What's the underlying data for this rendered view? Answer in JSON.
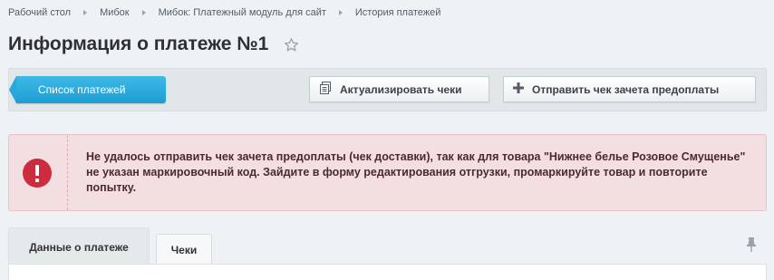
{
  "breadcrumb": [
    {
      "label": "Рабочий стол"
    },
    {
      "label": "Мибок"
    },
    {
      "label": "Мибок: Платежный модуль для сайт"
    },
    {
      "label": "История платежей"
    }
  ],
  "page": {
    "title": "Информация о платеже №1"
  },
  "toolbar": {
    "list_label": "Список платежей",
    "update_label": "Актуализировать чеки",
    "send_label": "Отправить чек зачета предоплаты"
  },
  "alert": {
    "message": "Не удалось отправить чек зачета предоплаты (чек доставки), так как для товара \"Нижнее белье Розовое Смущенье\" не указан маркировочный код. Зайдите в форму редактирования отгрузки, промаркируйте товар и повторите попытку."
  },
  "tabs": [
    {
      "label": "Данные о платеже",
      "active": true
    },
    {
      "label": "Чеки",
      "active": false
    }
  ],
  "colors": {
    "accent": "#1c9ed3",
    "error": "#cd2c3f",
    "alert_bg": "#f3dfe2"
  }
}
